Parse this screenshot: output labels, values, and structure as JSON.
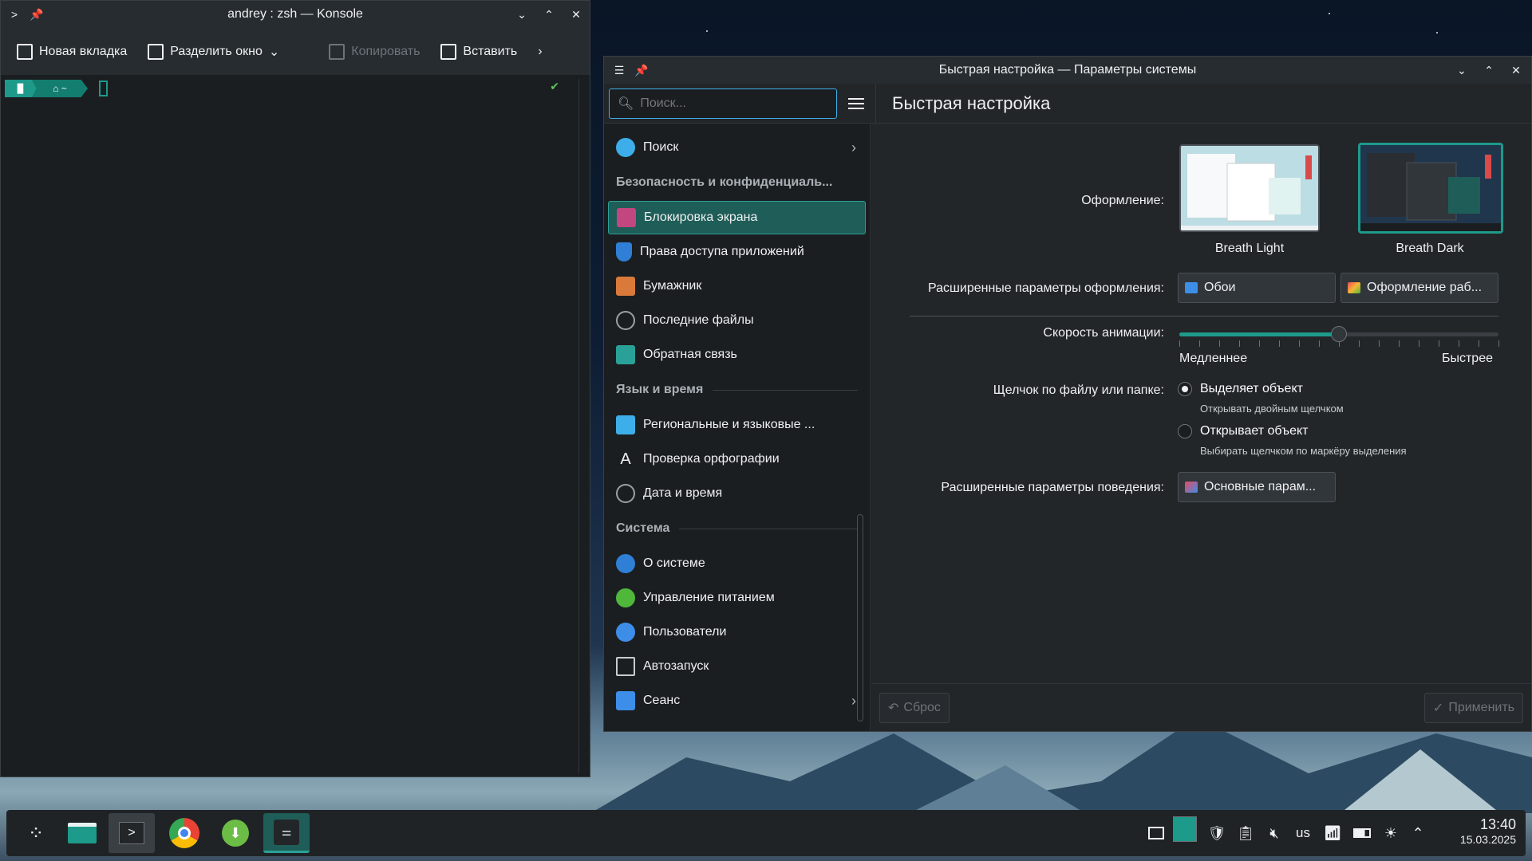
{
  "konsole": {
    "title": "andrey : zsh — Konsole",
    "toolbar": {
      "new_tab": "Новая вкладка",
      "split": "Разделить окно",
      "copy": "Копировать",
      "paste": "Вставить"
    },
    "prompt": {
      "home": "⌂ ~",
      "status": "✔"
    }
  },
  "settings": {
    "title": "Быстрая настройка — Параметры системы",
    "search_placeholder": "Поиск...",
    "page_title": "Быстрая настройка",
    "sidebar": {
      "search_item": "Поиск",
      "section_privacy": "Безопасность и конфиденциаль...",
      "lock_screen": "Блокировка экрана",
      "app_permissions": "Права доступа приложений",
      "wallet": "Бумажник",
      "recent_files": "Последние файлы",
      "feedback": "Обратная связь",
      "section_lang": "Язык и время",
      "regional": "Региональные и языковые ...",
      "spell": "Проверка орфографии",
      "datetime": "Дата и время",
      "section_system": "Система",
      "about": "О системе",
      "power": "Управление питанием",
      "users": "Пользователи",
      "autostart": "Автозапуск",
      "session": "Сеанс"
    },
    "main": {
      "appearance_label": "Оформление:",
      "theme_light": "Breath Light",
      "theme_dark": "Breath Dark",
      "advanced_appearance_label": "Расширенные параметры оформления:",
      "wallpaper_btn": "Обои",
      "desktop_theme_btn": "Оформление раб...",
      "animation_label": "Скорость анимации:",
      "anim_slower": "Медленнее",
      "anim_faster": "Быстрее",
      "animation_speed_fraction": 0.5,
      "click_label": "Щелчок по файлу или папке:",
      "opt_select": "Выделяет объект",
      "opt_select_hint": "Открывать двойным щелчком",
      "opt_open": "Открывает объект",
      "opt_open_hint": "Выбирать щелчком по маркёру выделения",
      "advanced_behavior_label": "Расширенные параметры поведения:",
      "general_btn": "Основные парам...",
      "reset_btn": "Сброс",
      "apply_btn": "Применить"
    }
  },
  "taskbar": {
    "lang": "us",
    "time": "13:40",
    "date": "15.03.2025"
  },
  "colors": {
    "accent": "#1d9a8a",
    "focus": "#3daee9"
  }
}
